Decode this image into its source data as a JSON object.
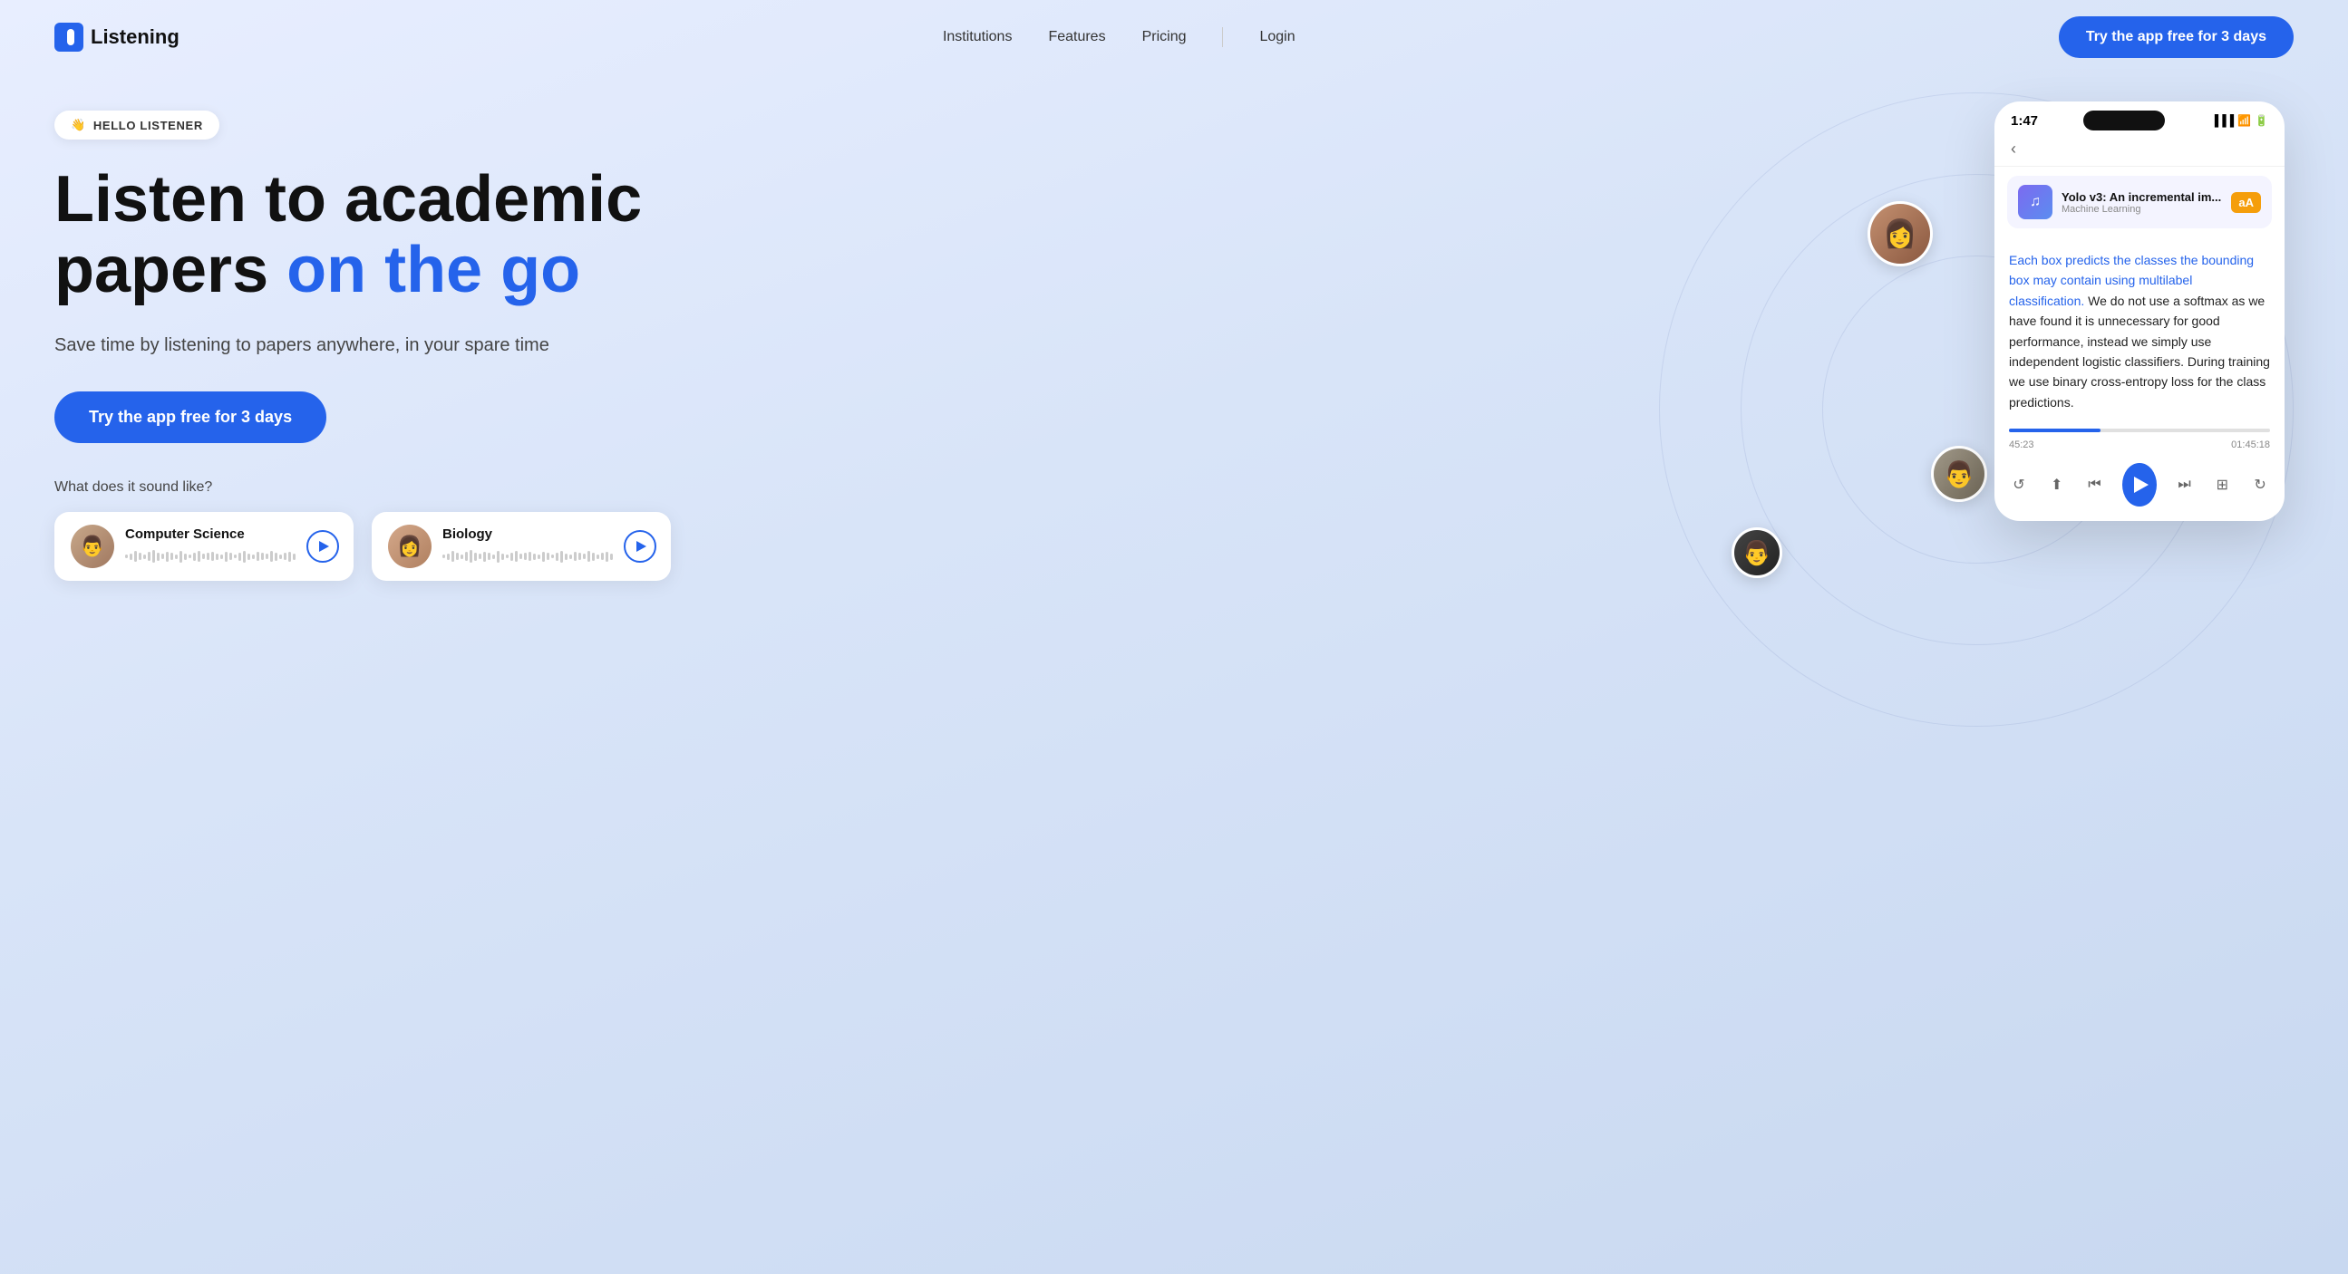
{
  "brand": {
    "name": "Listening",
    "logo_icon": "l"
  },
  "nav": {
    "links": [
      {
        "label": "Institutions",
        "id": "institutions"
      },
      {
        "label": "Features",
        "id": "features"
      },
      {
        "label": "Pricing",
        "id": "pricing"
      },
      {
        "label": "Login",
        "id": "login"
      }
    ],
    "cta": "Try the app free for 3 days"
  },
  "hero": {
    "badge_emoji": "👋",
    "badge_text": "HELLO LISTENER",
    "title_line1": "Listen to academic",
    "title_line2_normal": "papers ",
    "title_line2_highlight": "on the go",
    "subtitle": "Save time by listening to papers anywhere, in your spare time",
    "cta_label": "Try the app free for 3 days",
    "sound_label": "What does it sound like?",
    "audio_cards": [
      {
        "category": "Computer Science",
        "avatar_emoji": "👨"
      },
      {
        "category": "Biology",
        "avatar_emoji": "👩"
      }
    ]
  },
  "phone": {
    "time": "1:47",
    "paper_title": "Yolo v3: An incremental im...",
    "paper_category": "Machine Learning",
    "aa_label": "aA",
    "content_blue": "Each box predicts the classes the bounding box may contain using multilabel classification.",
    "content_normal": " We do not use a softmax as we have found it is unnecessary for good performance, instead we simply use independent logistic classifiers. During training we use binary cross-entropy loss for the class predictions.",
    "time_elapsed": "45:23",
    "time_remaining": "01:45:18",
    "progress_pct": 35
  },
  "colors": {
    "accent": "#2563eb",
    "amber": "#f59e0b",
    "bg_start": "#e8eeff",
    "bg_end": "#c8d8f0"
  }
}
